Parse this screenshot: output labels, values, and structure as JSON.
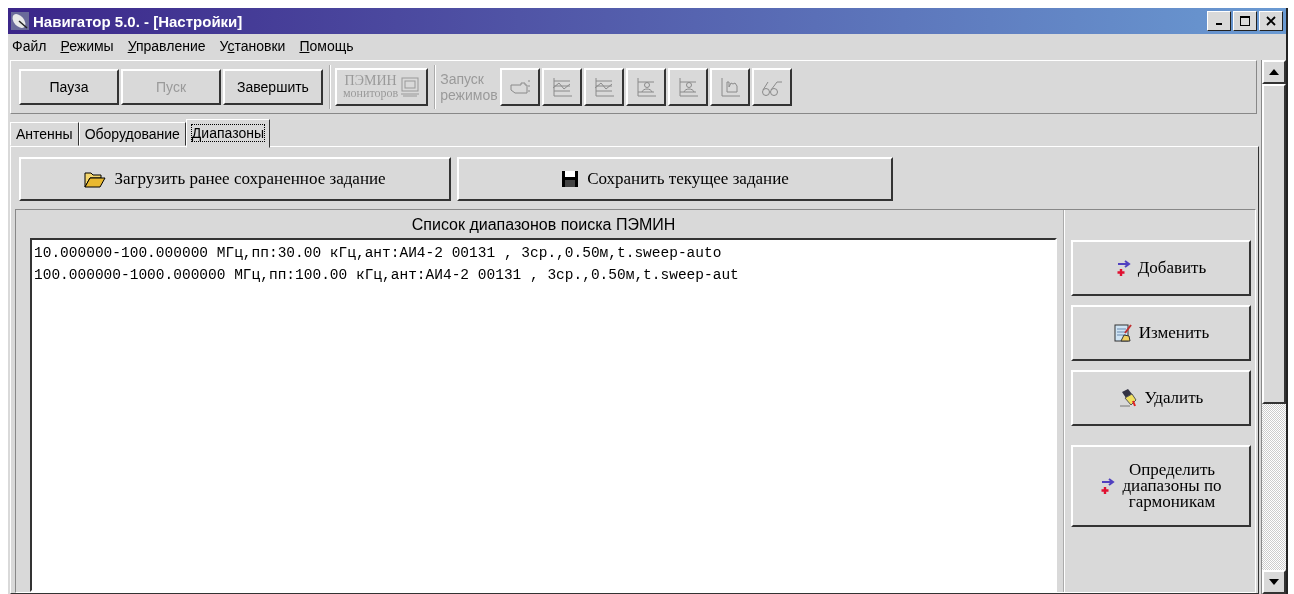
{
  "window": {
    "title": "Навигатор 5.0. - [Настройки]"
  },
  "menu": [
    {
      "pre": "Файл"
    },
    {
      "key": "Р",
      "post": "ежимы"
    },
    {
      "key": "У",
      "post": "правление"
    },
    {
      "pre": "У",
      "key": "с",
      "post": "тановки"
    },
    {
      "key": "П",
      "post": "омощь"
    }
  ],
  "toolbar": {
    "buttons": [
      {
        "label": "Пауза",
        "disabled": false
      },
      {
        "label": "Пуск",
        "disabled": true
      },
      {
        "label": "Завершить",
        "disabled": false
      }
    ],
    "monitor_button": {
      "line1": "ПЭМИН",
      "line2": "мониторов",
      "disabled": true
    },
    "modes_label": {
      "line1": "Запуск",
      "line2": "режимов",
      "disabled": true
    },
    "mode_buttons": [
      {
        "kind": "hand",
        "disabled": true
      },
      {
        "kind": "chart",
        "disabled": true
      },
      {
        "kind": "chart",
        "disabled": true
      },
      {
        "kind": "person-chart",
        "disabled": true
      },
      {
        "kind": "person-chart",
        "disabled": true
      },
      {
        "kind": "hand-chart",
        "disabled": true
      },
      {
        "kind": "glasses",
        "disabled": true
      }
    ]
  },
  "tabs": [
    {
      "label": "Антенны",
      "selected": false
    },
    {
      "label": "Оборудование",
      "selected": false
    },
    {
      "label": "Диапазоны",
      "selected": true
    }
  ],
  "task_buttons": [
    {
      "kind": "load",
      "label": "Загрузить ранее сохраненное задание"
    },
    {
      "kind": "save",
      "label": "Сохранить текущее задание"
    }
  ],
  "ranges": {
    "title": "Список диапазонов поиска ПЭМИН",
    "items": [
      "10.000000-100.000000 МГц,пп:30.00 кГц,ант:АИ4-2 00131 , 3ср.,0.50м,t.sweep-auto",
      "100.000000-1000.000000 МГц,пп:100.00 кГц,ант:АИ4-2 00131 , 3ср.,0.50м,t.sweep-aut"
    ]
  },
  "side_buttons": [
    {
      "kind": "add",
      "lines": [
        "Добавить"
      ]
    },
    {
      "kind": "edit",
      "lines": [
        "Изменить"
      ]
    },
    {
      "kind": "delete",
      "lines": [
        "Удалить"
      ]
    },
    {
      "kind": "add",
      "lines": [
        "Определить",
        "диапазоны по",
        "гармоникам"
      ]
    }
  ]
}
